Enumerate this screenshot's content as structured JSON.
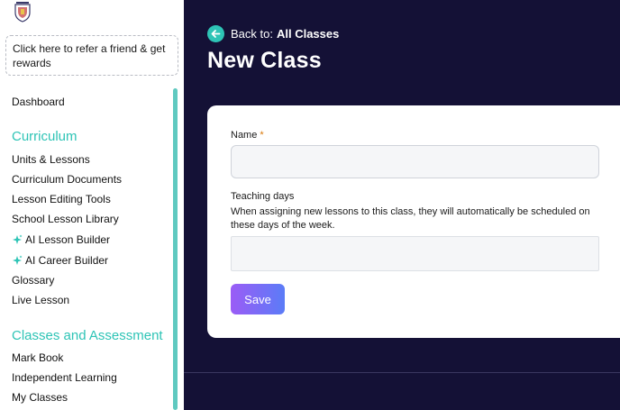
{
  "sidebar": {
    "logo_icon": "school-crest-icon",
    "refer_text": "Click here to refer a friend & get rewards",
    "items": {
      "dashboard": "Dashboard",
      "curriculum_heading": "Curriculum",
      "units_lessons": "Units & Lessons",
      "curriculum_documents": "Curriculum Documents",
      "lesson_editing_tools": "Lesson Editing Tools",
      "school_lesson_library": "School Lesson Library",
      "ai_lesson_builder": "AI Lesson Builder",
      "ai_career_builder": "AI Career Builder",
      "glossary": "Glossary",
      "live_lesson": "Live Lesson",
      "classes_heading": "Classes and Assessment",
      "mark_book": "Mark Book",
      "independent_learning": "Independent Learning",
      "my_classes": "My Classes"
    },
    "accent_color": "#2ec4b6"
  },
  "header": {
    "back_prefix": "Back to:",
    "back_target": "All Classes",
    "title": "New Class"
  },
  "form": {
    "name_label": "Name",
    "required_mark": "*",
    "name_value": "",
    "teaching_days_label": "Teaching days",
    "teaching_days_help": "When assigning new lessons to this class, they will automatically be scheduled on these days of the week.",
    "save_label": "Save"
  },
  "colors": {
    "main_bg": "#141136",
    "accent": "#2ec4b6",
    "button_gradient_start": "#9b5cf6",
    "button_gradient_end": "#5b7cf7"
  }
}
